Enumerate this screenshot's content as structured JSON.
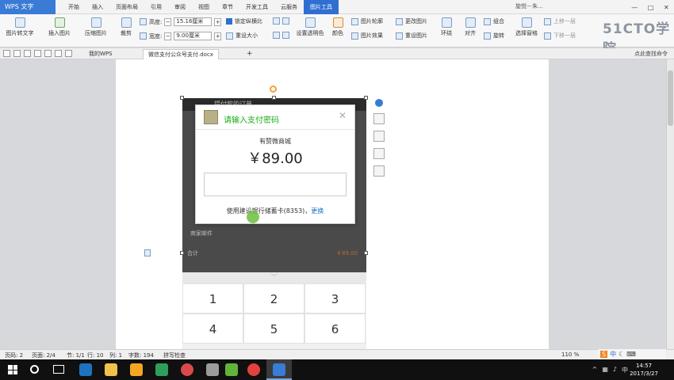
{
  "app": {
    "name": "WPS 文字",
    "menu_tabs": [
      "开始",
      "插入",
      "页面布局",
      "引用",
      "审阅",
      "视图",
      "章节",
      "开发工具",
      "云服务",
      "图片工具"
    ],
    "active_tab": "图片工具",
    "user": "旋悦－朱...",
    "watermark": "51CTO学院"
  },
  "ribbon": {
    "picture_to_text": "图片转文字",
    "insert_picture": "插入图片",
    "compress_picture": "压缩图片",
    "crop": "裁剪",
    "height_label": "高度:",
    "height_value": "15.16厘米",
    "width_label": "宽度:",
    "width_value": "9.00厘米",
    "lock_ratio": "锁定纵横比",
    "reset_size": "重设大小",
    "set_transparent": "设置透明色",
    "color": "颜色",
    "picture_outline": "图片轮廓",
    "picture_effect": "图片效果",
    "change_picture": "更改图片",
    "reset_picture": "重设图片",
    "wrap": "环绕",
    "align": "对齐",
    "group": "组合",
    "rotate": "旋转",
    "selection_pane": "选择窗格",
    "bring_forward": "上移一层",
    "send_backward": "下移一层"
  },
  "quickbar": {
    "tabs": [
      "我的WPS",
      "微信支付公众号支付.docx"
    ],
    "active_doc": "微信支付公众号支付.docx",
    "help_search": "点此查找命令"
  },
  "phone_ui": {
    "header_title": "提付款的订单",
    "background_rows": [
      {
        "label": "商家邮件",
        "value": ""
      },
      {
        "label": "合计",
        "value": "￥89.00"
      }
    ],
    "keypad_keys": [
      "1",
      "2",
      "3",
      "4",
      "5",
      "6"
    ]
  },
  "dialog": {
    "title": "请输入支付密码",
    "merchant": "有赞微商城",
    "amount": "￥89.00",
    "card_line": "使用建设银行储蓄卡(8353)，",
    "change_link": "更换"
  },
  "statusbar": {
    "page": "页码: 2",
    "pages": "页面: 2/4",
    "section": "节: 1/1",
    "row": "行: 10",
    "col": "列: 1",
    "words": "字数: 194",
    "spell": "拼写检查",
    "zoom": "110 %"
  },
  "taskbar": {
    "ime": "中",
    "time": "14:57",
    "date": "2017/3/27"
  },
  "colors": {
    "accent": "#2f6fd1",
    "wechat_green": "#1aad19",
    "link_blue": "#1a73c9",
    "taskbar": "#101010"
  }
}
